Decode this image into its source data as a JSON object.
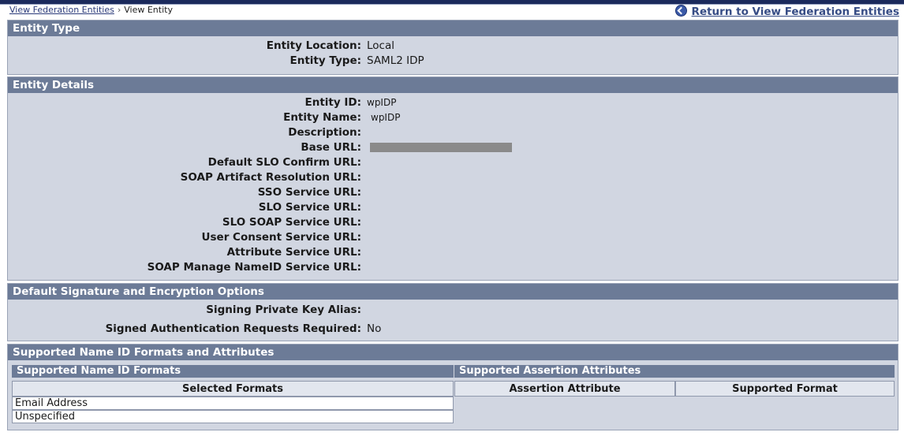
{
  "breadcrumb": {
    "link": "View Federation Entities",
    "separator": "›",
    "current": "View Entity"
  },
  "return_link": "Return to View Federation Entities",
  "sections": {
    "entity_type": {
      "title": "Entity Type",
      "rows": [
        {
          "label": "Entity Location:",
          "value": "Local"
        },
        {
          "label": "Entity Type:",
          "value": "SAML2 IDP"
        }
      ]
    },
    "entity_details": {
      "title": "Entity Details",
      "rows": [
        {
          "label": "Entity ID:",
          "value": "wpIDP"
        },
        {
          "label": "Entity Name:",
          "value": "wpIDP"
        },
        {
          "label": "Description:",
          "value": ""
        },
        {
          "label": "Base URL:",
          "value": ""
        },
        {
          "label": "Default SLO Confirm URL:",
          "value": ""
        },
        {
          "label": "SOAP Artifact Resolution URL:",
          "value": ""
        },
        {
          "label": "SSO Service URL:",
          "value": ""
        },
        {
          "label": "SLO Service URL:",
          "value": ""
        },
        {
          "label": "SLO SOAP Service URL:",
          "value": ""
        },
        {
          "label": "User Consent Service URL:",
          "value": ""
        },
        {
          "label": "Attribute Service URL:",
          "value": ""
        },
        {
          "label": "SOAP Manage NameID Service URL:",
          "value": ""
        }
      ]
    },
    "signature": {
      "title": "Default Signature and Encryption Options",
      "rows": [
        {
          "label": "Signing Private Key Alias:",
          "value": ""
        },
        {
          "label": "Signed Authentication Requests Required:",
          "value": "No"
        }
      ]
    },
    "name_id": {
      "title": "Supported Name ID Formats and Attributes",
      "formats_title": "Supported Name ID Formats",
      "formats_column": "Selected Formats",
      "formats": [
        "Email Address",
        "Unspecified"
      ],
      "attributes_title": "Supported Assertion Attributes",
      "attr_columns": [
        "Assertion Attribute",
        "Supported Format"
      ]
    }
  }
}
